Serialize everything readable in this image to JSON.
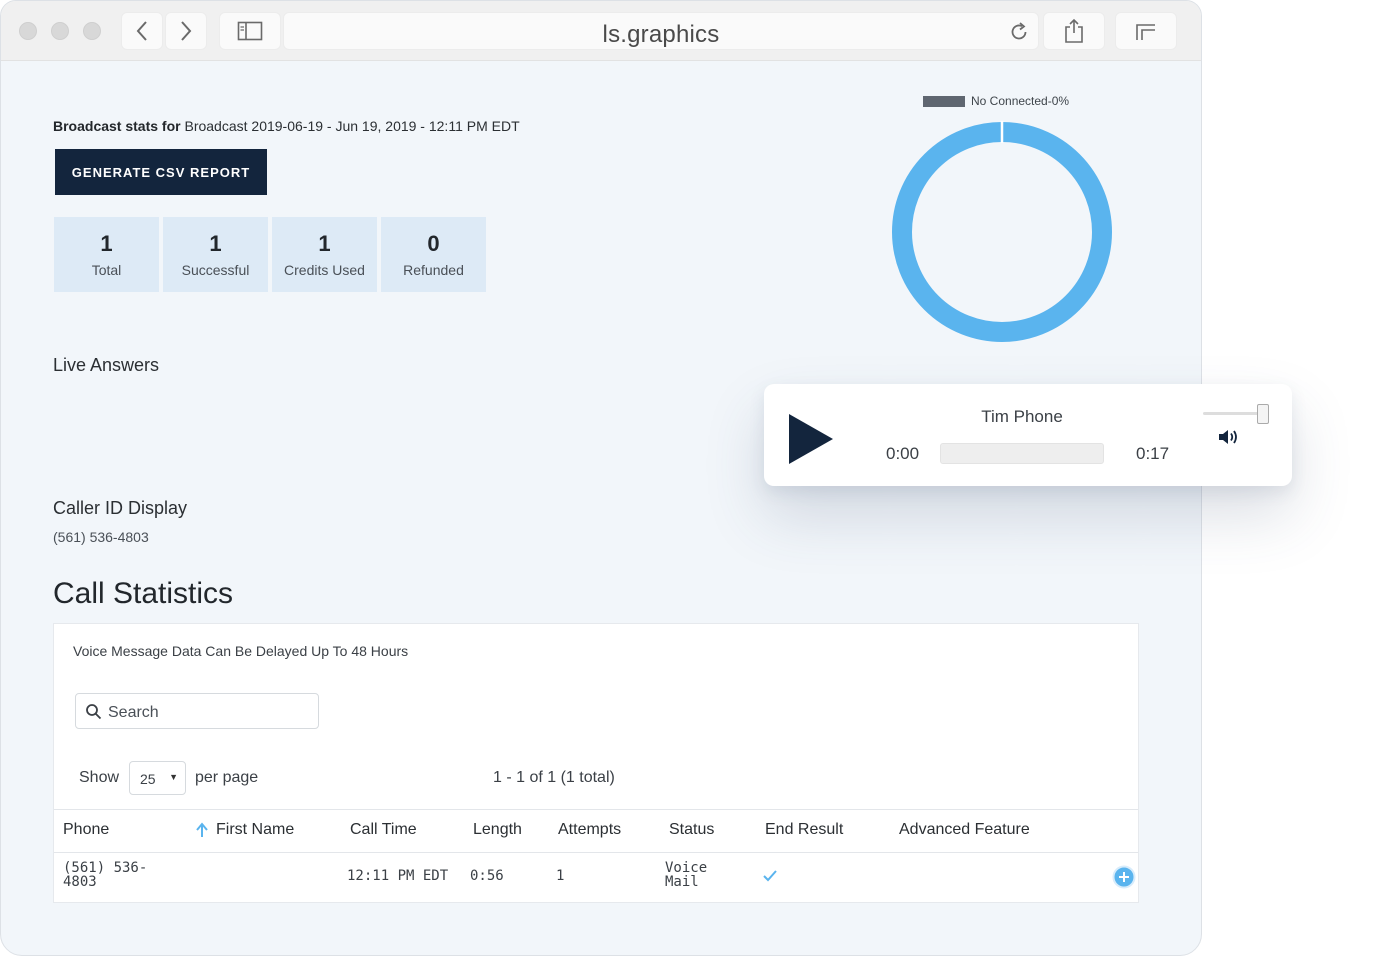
{
  "browser": {
    "url": "ls.graphics"
  },
  "header": {
    "stats_prefix": "Broadcast stats for",
    "stats_value": "Broadcast 2019-06-19 - Jun 19, 2019 - 12:11 PM EDT",
    "csv_button": "GENERATE CSV REPORT"
  },
  "stats": [
    {
      "value": "1",
      "label": "Total"
    },
    {
      "value": "1",
      "label": "Successful"
    },
    {
      "value": "1",
      "label": "Credits Used"
    },
    {
      "value": "0",
      "label": "Refunded"
    }
  ],
  "donut": {
    "legend": "No Connected-0%",
    "legend_color": "#5f6670",
    "ring_color": "#5ab4ee"
  },
  "live_answers": {
    "title": "Live Answers"
  },
  "caller_id": {
    "title": "Caller ID Display",
    "value": "(561) 536-4803"
  },
  "player": {
    "title": "Tim Phone",
    "current_time": "0:00",
    "duration": "0:17",
    "progress": 0,
    "volume": 1.0
  },
  "call_stats": {
    "title": "Call Statistics",
    "note": "Voice Message Data Can Be Delayed Up To 48 Hours",
    "search_placeholder": "Search",
    "show_label": "Show",
    "per_page_value": "25",
    "per_page_label": "per page",
    "pagination": "1 - 1 of 1 (1 total)",
    "columns": [
      "Phone",
      "First Name",
      "Call Time",
      "Length",
      "Attempts",
      "Status",
      "End Result",
      "Advanced Feature"
    ],
    "sorted_column": "First Name",
    "rows": [
      {
        "phone_line1": "(561) 536-",
        "phone_line2": "4803",
        "first_name": "",
        "call_time": "12:11 PM EDT",
        "length": "0:56",
        "attempts": "1",
        "status_line1": "Voice",
        "status_line2": "Mail",
        "end_result": "check-icon",
        "advanced_feature": "plus-circle-icon"
      }
    ]
  }
}
